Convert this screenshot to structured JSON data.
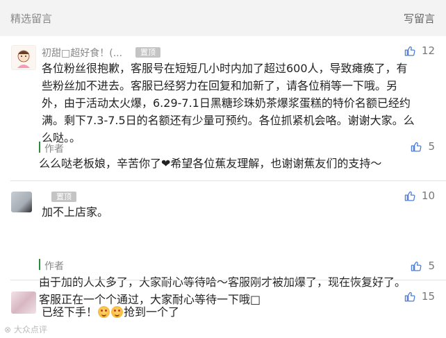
{
  "header": {
    "title": "精选留言",
    "write_label": "写留言"
  },
  "comments": [
    {
      "nickname": "初甜□超好食！(...",
      "pin_label": "置顶",
      "likes": "12",
      "lines": [
        "各位粉丝很抱歉，客服号在短短几小时内加了超过600人，导致瘫痪了，有",
        "些粉丝加不进去。客服已经努力在回复和加新了，请各位稍等一下哦。另",
        "外，由于活动太火爆，6.29-7.1日黑糖珍珠奶茶爆浆蛋糕的特价名额已经约",
        "满。剩下7.3-7.5日的名额还有少量可预约。各位抓紧机会咯。谢谢大家。么",
        "么哒。。"
      ],
      "reply": {
        "author": "作者",
        "likes": "5",
        "text_before": "么么哒老板娘，辛苦你了",
        "heart": "❤",
        "text_after": "希望各位蕉友理解，也谢谢蕉友们的支持～"
      }
    },
    {
      "nickname": "",
      "pin_label": "置顶",
      "likes": "10",
      "lines": [
        "加不上店家。"
      ],
      "reply": {
        "author": "作者",
        "likes": "5",
        "lines": [
          "由于加的人太多了，大家耐心等待哈～客服刚才被加爆了，现在恢复好了。",
          "客服正在一个个通过，大家耐心等待一下哦□"
        ]
      }
    },
    {
      "nickname": "",
      "likes": "15",
      "text_before": "已经下手！",
      "text_after": "抢到一个了"
    }
  ],
  "watermark": "大众点评",
  "colors": {
    "accent_green": "#2e8b3a",
    "pin_bg": "#c4c4c4"
  },
  "icons": {
    "like": "thumbs-up-icon",
    "emoji": "heart-eyes-emoji-icon",
    "heart": "heart-icon"
  }
}
